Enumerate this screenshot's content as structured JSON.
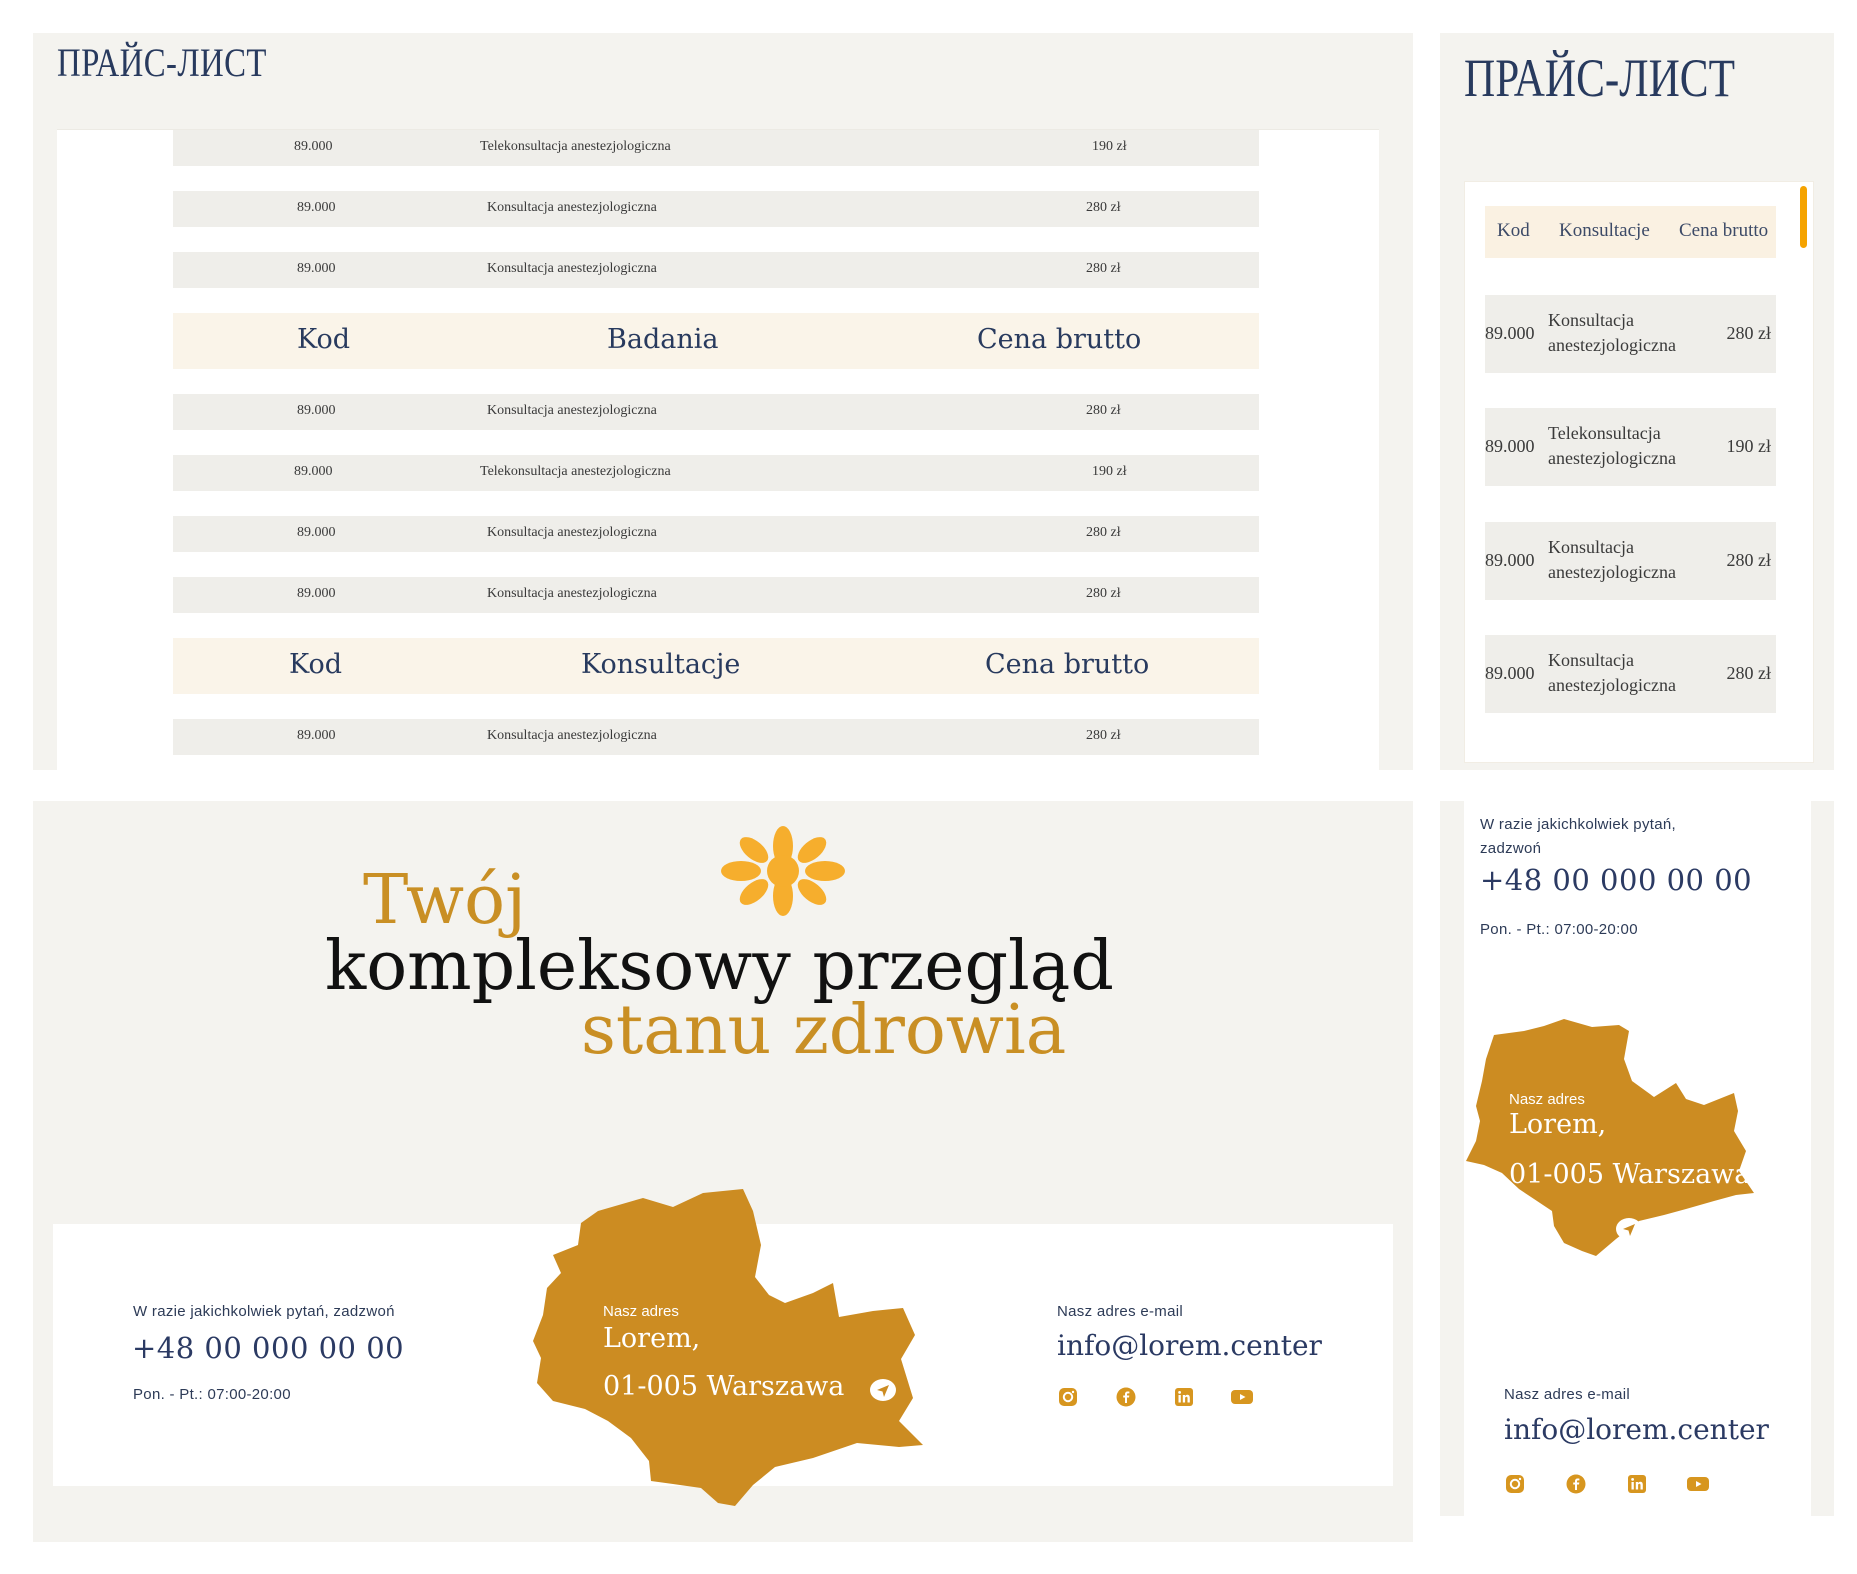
{
  "price_list": {
    "title": "ПРАЙС-ЛИСТ",
    "top_rows": [
      {
        "code": "89.000",
        "name": "Telekonsultacja anestezjologiczna",
        "price": "190 zł"
      },
      {
        "code": "89.000",
        "name": "Konsultacja anestezjologiczna",
        "price": "280 zł"
      },
      {
        "code": "89.000",
        "name": "Konsultacja anestezjologiczna",
        "price": "280 zł"
      }
    ],
    "header_badania": {
      "code": "Kod",
      "name": "Badania",
      "price": "Cena brutto"
    },
    "badania_rows": [
      {
        "code": "89.000",
        "name": "Konsultacja anestezjologiczna",
        "price": "280 zł"
      },
      {
        "code": "89.000",
        "name": "Telekonsultacja anestezjologiczna",
        "price": "190 zł"
      },
      {
        "code": "89.000",
        "name": "Konsultacja anestezjologiczna",
        "price": "280 zł"
      },
      {
        "code": "89.000",
        "name": "Konsultacja anestezjologiczna",
        "price": "280 zł"
      }
    ],
    "header_konsultacje": {
      "code": "Kod",
      "name": "Konsultacje",
      "price": "Cena brutto"
    },
    "konsultacje_rows": [
      {
        "code": "89.000",
        "name": "Konsultacja anestezjologiczna",
        "price": "280 zł"
      }
    ]
  },
  "mobile_price_list": {
    "title": "ПРАЙС-ЛИСТ",
    "header": {
      "code": "Kod",
      "name": "Konsultacje",
      "price": "Cena brutto"
    },
    "rows": [
      {
        "code": "89.000",
        "name": "Konsultacja anestezjologiczna",
        "price": "280 zł"
      },
      {
        "code": "89.000",
        "name": "Telekonsultacja anestezjologiczna",
        "price": "190 zł"
      },
      {
        "code": "89.000",
        "name": "Konsultacja anestezjologiczna",
        "price": "280 zł"
      },
      {
        "code": "89.000",
        "name": "Konsultacja anestezjologiczna",
        "price": "280 zł"
      }
    ]
  },
  "hero": {
    "line1": "Twój",
    "line2": "kompleksowy przegląd",
    "line3": "stanu zdrowia"
  },
  "contact": {
    "phone_label": "W razie jakichkolwiek pytań, zadzwoń",
    "phone": "+48 00 000 00 00",
    "hours": "Pon. - Pt.: 07:00-20:00",
    "address_label": "Nasz adres",
    "address_line1": "Lorem,",
    "address_line2": "01-005 Warszawa",
    "email_label": "Nasz adres e-mail",
    "email": "info@lorem.center",
    "social": [
      "instagram-icon",
      "facebook-icon",
      "linkedin-icon",
      "youtube-icon"
    ]
  },
  "mobile_contact": {
    "phone_label": "W razie jakichkolwiek pytań, zadzwoń",
    "phone": "+48 00 000 00 00",
    "hours": "Pon. - Pt.: 07:00-20:00",
    "address_label": "Nasz adres",
    "address_line1": "Lorem,",
    "address_line2": "01-005 Warszawa",
    "email_label": "Nasz adres e-mail",
    "email": "info@lorem.center"
  },
  "colors": {
    "accent": "#f5a300",
    "map": "#cc8c22",
    "heading": "#283a5e",
    "gold_text": "#c98f24",
    "panel_bg": "#f4f3ef",
    "row_bg": "#efeeea",
    "header_bg": "#faf4e9"
  }
}
